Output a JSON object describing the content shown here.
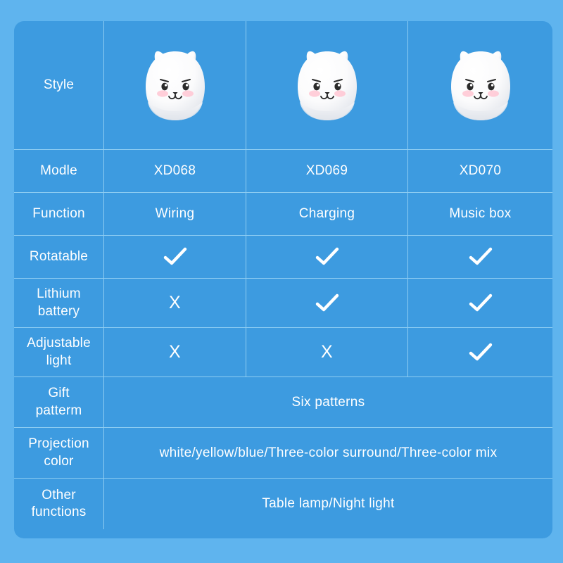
{
  "theme": {
    "background_color": "#5fb4ee",
    "panel_color": "#3d9be0",
    "grid_line_color": "#8ecdf2",
    "text_color": "#ffffff"
  },
  "table": {
    "columns": [
      "",
      "XD068",
      "XD069",
      "XD070"
    ],
    "rows": [
      {
        "label": "Style",
        "type": "image",
        "cells": [
          "cat-lamp-image",
          "cat-lamp-image",
          "cat-lamp-image"
        ]
      },
      {
        "label": "Modle",
        "type": "text",
        "cells": [
          "XD068",
          "XD069",
          "XD070"
        ]
      },
      {
        "label": "Function",
        "type": "text",
        "cells": [
          "Wiring",
          "Charging",
          "Music box"
        ]
      },
      {
        "label": "Rotatable",
        "type": "mark",
        "cells": [
          "check",
          "check",
          "check"
        ]
      },
      {
        "label": "Lithium battery",
        "label_line1": "Lithium",
        "label_line2": "battery",
        "type": "mark",
        "cells": [
          "x",
          "check",
          "check"
        ]
      },
      {
        "label": "Adjustable light",
        "label_line1": "Adjustable",
        "label_line2": "light",
        "type": "mark",
        "cells": [
          "x",
          "x",
          "check"
        ]
      },
      {
        "label": "Gift patterm",
        "label_line1": "Gift",
        "label_line2": "patterm",
        "type": "merged",
        "value": "Six patterns"
      },
      {
        "label": "Projection color",
        "label_line1": "Projection",
        "label_line2": "color",
        "type": "merged",
        "value": "white/yellow/blue/Three-color surround/Three-color mix"
      },
      {
        "label": "Other functions",
        "label_line1": "Other",
        "label_line2": "functions",
        "type": "merged",
        "value": "Table lamp/Night light"
      }
    ]
  },
  "marks": {
    "check_symbol": "check-icon",
    "x_symbol": "X"
  }
}
